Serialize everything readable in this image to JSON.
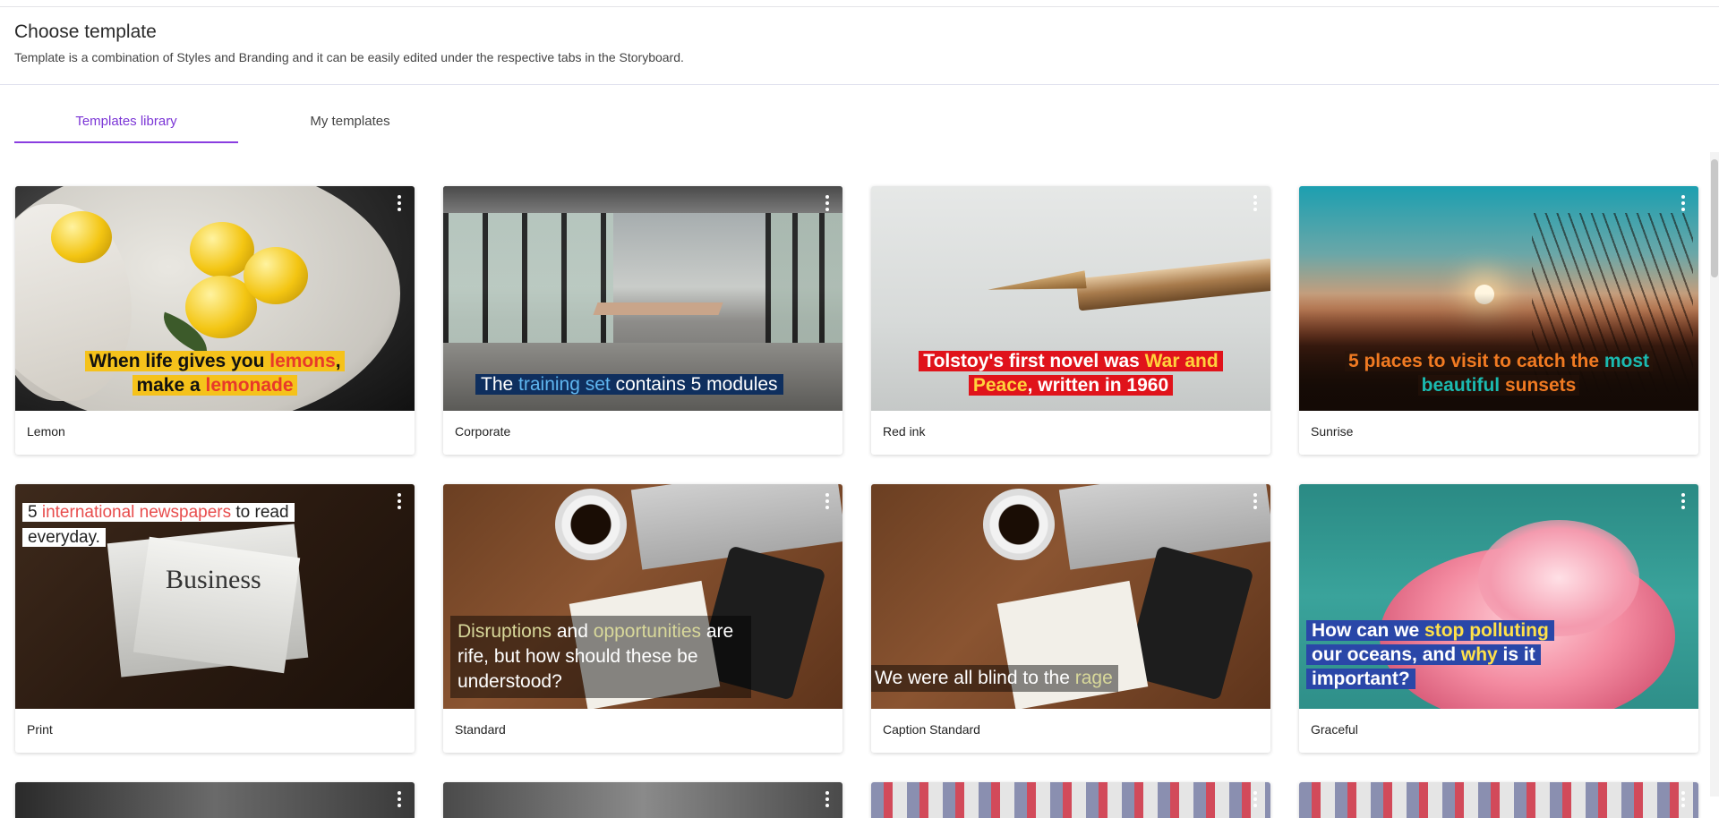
{
  "header": {
    "title": "Choose template",
    "subtitle": "Template is a combination of Styles and Branding and it can be easily edited under the respective tabs in the Storyboard."
  },
  "tabs": [
    {
      "label": "Templates library",
      "active": true
    },
    {
      "label": "My templates",
      "active": false
    }
  ],
  "templates": [
    {
      "name": "Lemon",
      "caption_line1": "When life gives you ",
      "caption_hl1": "lemons",
      "caption_end1": ",",
      "caption_line2": "make a ",
      "caption_hl2": "lemonade"
    },
    {
      "name": "Corporate",
      "caption_a": "The ",
      "caption_hl": "training set",
      "caption_b": " contains 5 modules"
    },
    {
      "name": "Red ink",
      "caption_a": "Tolstoy's first novel was ",
      "caption_hl1": "War and",
      "caption_hl2": "Peace",
      "caption_b": ", written in 1960"
    },
    {
      "name": "Sunrise",
      "caption_a": "5 places to visit to catch the ",
      "caption_hl1": "most",
      "caption_hl2": "beautiful",
      "caption_b": " sunsets"
    },
    {
      "name": "Print",
      "caption_a": "5 ",
      "caption_hl": "international newspapers",
      "caption_b": " to read",
      "caption_c": "everyday.",
      "paper_text": "Business"
    },
    {
      "name": "Standard",
      "caption_hl1": "Disruptions",
      "caption_a": " and ",
      "caption_hl2": "opportunities",
      "caption_b": " are",
      "caption_c": "rife, but how should these be",
      "caption_d": "understood?"
    },
    {
      "name": "Caption Standard",
      "caption_a": "We were all blind to the ",
      "caption_hl": "rage"
    },
    {
      "name": "Graceful",
      "caption_a": "How can we ",
      "caption_hl1": "stop polluting",
      "caption_b": "our oceans, and ",
      "caption_hl2": "why",
      "caption_c": " is it",
      "caption_d": "important?"
    }
  ],
  "colors": {
    "accent": "#7b35d6",
    "lemon_box": "#f5c21b",
    "lemon_hl": "#e8392a",
    "corporate_box": "#0f2f5e",
    "corporate_hl": "#5fb6f0",
    "redink_box": "#e0131b",
    "redink_hl": "#ffd23c",
    "sunrise_orange": "#f07a22",
    "sunrise_teal": "#1bbab0",
    "print_hl": "#e84d4d",
    "standard_hl": "#d8d89a",
    "graceful_box": "#2a47a8",
    "graceful_hl": "#ffe14a"
  },
  "icons": {
    "card_menu": "more-vertical-icon"
  }
}
